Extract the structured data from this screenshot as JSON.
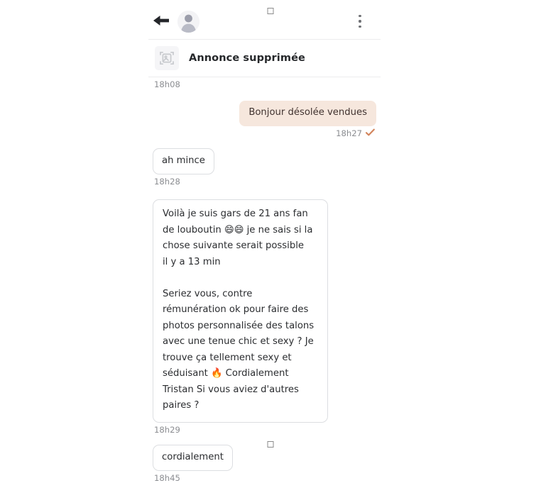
{
  "window": {
    "crop_mark_top": "crop-mark-square",
    "crop_mark_bottom": "crop-mark-square"
  },
  "header": {
    "back_icon": "back-arrow-icon",
    "avatar_icon": "default-user-avatar",
    "menu_icon": "kebab-menu-icon"
  },
  "listing": {
    "thumbnail_icon": "deleted-image-placeholder-icon",
    "title": "Annonce supprimée",
    "timestamp": "18h08"
  },
  "messages": [
    {
      "side": "right",
      "text": "Bonjour désolée vendues",
      "timestamp": "18h27",
      "status_icon": "read-check-icon"
    },
    {
      "side": "left",
      "text": "ah mince",
      "timestamp": "18h28"
    },
    {
      "side": "left",
      "text": "Voilà je suis gars de 21 ans fan de louboutin 😄😄 je ne sais si la chose suivante serait possible\nil y a 13 min\n\nSeriez vous, contre rémunération ok pour faire des photos personnalisée des talons avec une tenue chic et sexy ? Je trouve ça tellement sexy et séduisant 🔥 Cordialement Tristan Si vous aviez d'autres paires ?",
      "timestamp": "18h29"
    },
    {
      "side": "left",
      "text": "cordialement",
      "timestamp": "18h45"
    }
  ],
  "colors": {
    "sent_bubble_bg": "#f6e7dd",
    "sent_bubble_text": "#413330",
    "received_bubble_border": "#dcdee1",
    "timestamp_text": "#8b8d91",
    "read_check": "#d2835a"
  }
}
